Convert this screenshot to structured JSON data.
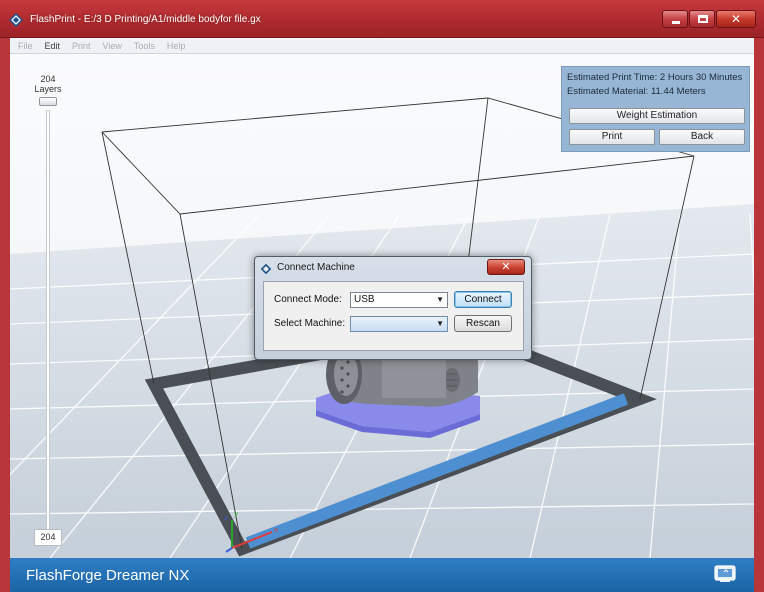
{
  "window": {
    "title": "FlashPrint - E:/3 D Printing/A1/middle bodyfor file.gx"
  },
  "menu": {
    "items": [
      {
        "label": "File",
        "active": false
      },
      {
        "label": "Edit",
        "active": true
      },
      {
        "label": "Print",
        "active": false
      },
      {
        "label": "View",
        "active": false
      },
      {
        "label": "Tools",
        "active": false
      },
      {
        "label": "Help",
        "active": false
      }
    ]
  },
  "layers": {
    "count": "204",
    "label": "Layers",
    "current": "204"
  },
  "estimate": {
    "time_line": "Estimated Print Time: 2 Hours 30 Minutes",
    "material_line": "Estimated Material:   11.44 Meters",
    "weight_button": "Weight Estimation",
    "print_button": "Print",
    "back_button": "Back"
  },
  "dialog": {
    "title": "Connect Machine",
    "mode_label": "Connect Mode:",
    "mode_value": "USB",
    "machine_label": "Select Machine:",
    "machine_value": "",
    "connect_button": "Connect",
    "rescan_button": "Rescan"
  },
  "statusbar": {
    "brand": "FlashForge Dreamer NX"
  },
  "colors": {
    "accent": "#1b64a6",
    "titlebar": "#b32d31",
    "panel": "#97b6d6",
    "model": "#8a8aea"
  },
  "icons": [
    "flashforge-logo-icon",
    "minimize-icon",
    "maximize-icon",
    "close-icon",
    "machine-screen-icon",
    "axis-gizmo-icon"
  ]
}
